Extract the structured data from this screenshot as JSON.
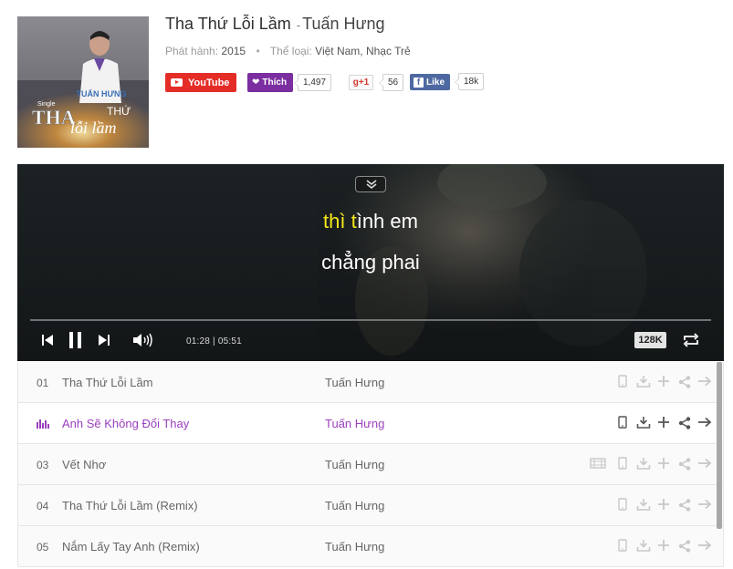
{
  "song": {
    "title": "Tha Thứ Lỗi Lầm",
    "separator": "-",
    "artist": "Tuấn Hưng",
    "release_label": "Phát hành:",
    "release_year": "2015",
    "genre_label": "Thể loại:",
    "genres": "Việt Nam, Nhạc Trẻ"
  },
  "cover": {
    "singer_name": "TUẤN HƯNG",
    "badge": "Single",
    "title_line1": "THA",
    "title_line2": "THỨ",
    "title_line3": "lỗi lầm"
  },
  "social": {
    "youtube_label": "YouTube",
    "like_label": "Thích",
    "like_count": "1,497",
    "gplus_label": "g+1",
    "gplus_count": "56",
    "fb_label": "Like",
    "fb_count": "18k"
  },
  "player": {
    "lyric_line1_highlight": "thì t",
    "lyric_line1_rest": "ình em",
    "lyric_line2": "chẳng phai",
    "current_time": "01:28",
    "time_sep": "|",
    "duration": "05:51",
    "quality": "128K",
    "progress": 0.25
  },
  "tracks": [
    {
      "num": "01",
      "name": "Tha Thứ Lỗi Lầm",
      "artist": "Tuấn Hưng",
      "active": false,
      "has_video": false
    },
    {
      "num": "02",
      "name": "Anh Sẽ Không Đổi Thay",
      "artist": "Tuấn Hưng",
      "active": true,
      "has_video": false
    },
    {
      "num": "03",
      "name": "Vết Nhơ",
      "artist": "Tuấn Hưng",
      "active": false,
      "has_video": true
    },
    {
      "num": "04",
      "name": "Tha Thứ Lỗi Lầm (Remix)",
      "artist": "Tuấn Hưng",
      "active": false,
      "has_video": false
    },
    {
      "num": "05",
      "name": "Nắm Lấy Tay Anh (Remix)",
      "artist": "Tuấn Hưng",
      "active": false,
      "has_video": false
    }
  ],
  "colors": {
    "accent": "#9b3fbf",
    "lyric_highlight": "#f5e71a",
    "youtube": "#e52d27",
    "facebook": "#4e69a2"
  }
}
